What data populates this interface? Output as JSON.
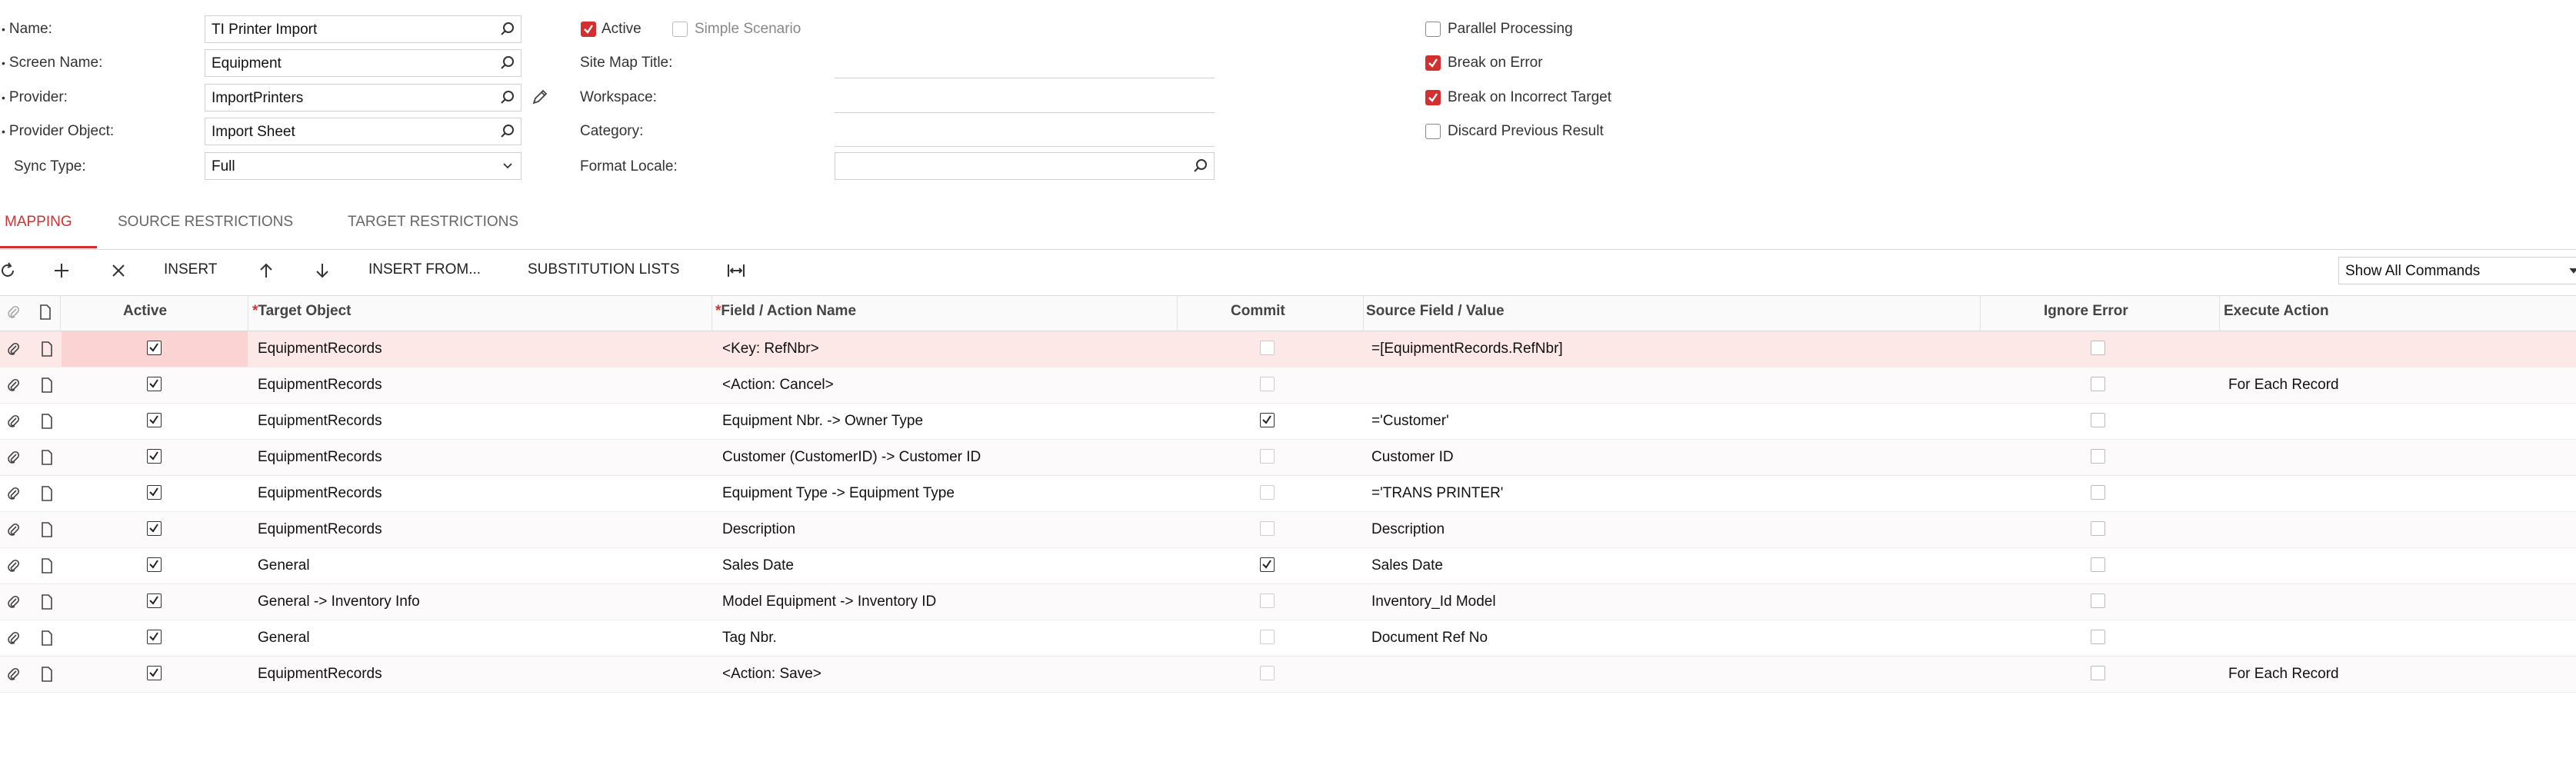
{
  "form": {
    "name_label": "Name:",
    "name_value": "TI Printer Import",
    "screen_label": "Screen Name:",
    "screen_value": "Equipment",
    "provider_label": "Provider:",
    "provider_value": "ImportPrinters",
    "provider_object_label": "Provider Object:",
    "provider_object_value": "Import Sheet",
    "sync_type_label": "Sync Type:",
    "sync_type_value": "Full",
    "active_label": "Active",
    "active_checked": true,
    "simple_label": "Simple Scenario",
    "simple_checked": false,
    "site_map_label": "Site Map Title:",
    "workspace_label": "Workspace:",
    "category_label": "Category:",
    "format_locale_label": "Format Locale:",
    "parallel_label": "Parallel Processing",
    "parallel_checked": false,
    "break_error_label": "Break on Error",
    "break_error_checked": true,
    "break_target_label": "Break on Incorrect Target",
    "break_target_checked": true,
    "discard_label": "Discard Previous Result",
    "discard_checked": false
  },
  "tabs": [
    "MAPPING",
    "SOURCE RESTRICTIONS",
    "TARGET RESTRICTIONS"
  ],
  "toolbar": {
    "insert": "INSERT",
    "insert_from": "INSERT FROM...",
    "substitution": "SUBSTITUTION LISTS",
    "commands_select": "Show All Commands"
  },
  "grid": {
    "columns": {
      "active": "Active",
      "target": "Target Object",
      "field": "Field / Action Name",
      "commit": "Commit",
      "source": "Source Field / Value",
      "ignore": "Ignore Error",
      "execute": "Execute Action"
    },
    "rows": [
      {
        "active": true,
        "target": "EquipmentRecords",
        "field": "<Key: RefNbr>",
        "commit": false,
        "source": "=[EquipmentRecords.RefNbr]",
        "ignore": false,
        "execute": ""
      },
      {
        "active": true,
        "target": "EquipmentRecords",
        "field": "<Action: Cancel>",
        "commit": false,
        "source": "",
        "ignore": false,
        "execute": "For Each Record"
      },
      {
        "active": true,
        "target": "EquipmentRecords",
        "field": "Equipment Nbr. -> Owner Type",
        "commit": true,
        "source": "='Customer'",
        "ignore": false,
        "execute": ""
      },
      {
        "active": true,
        "target": "EquipmentRecords",
        "field": "Customer (CustomerID) -> Customer ID",
        "commit": false,
        "source": "Customer ID",
        "ignore": false,
        "execute": ""
      },
      {
        "active": true,
        "target": "EquipmentRecords",
        "field": "Equipment Type -> Equipment Type",
        "commit": false,
        "source": "='TRANS PRINTER'",
        "ignore": false,
        "execute": ""
      },
      {
        "active": true,
        "target": "EquipmentRecords",
        "field": "Description",
        "commit": false,
        "source": "Description",
        "ignore": false,
        "execute": ""
      },
      {
        "active": true,
        "target": "General",
        "field": "Sales Date",
        "commit": true,
        "source": "Sales Date",
        "ignore": false,
        "execute": ""
      },
      {
        "active": true,
        "target": "General -> Inventory Info",
        "field": "Model Equipment -> Inventory ID",
        "commit": false,
        "source": "Inventory_Id Model",
        "ignore": false,
        "execute": ""
      },
      {
        "active": true,
        "target": "General",
        "field": "Tag Nbr.",
        "commit": false,
        "source": "Document Ref No",
        "ignore": false,
        "execute": ""
      },
      {
        "active": true,
        "target": "EquipmentRecords",
        "field": "<Action: Save>",
        "commit": false,
        "source": "",
        "ignore": false,
        "execute": "For Each Record"
      }
    ]
  },
  "colors": {
    "accent": "#d32f2f",
    "selected_row": "#fde8e8",
    "active_cell": "#fbd3d3"
  }
}
